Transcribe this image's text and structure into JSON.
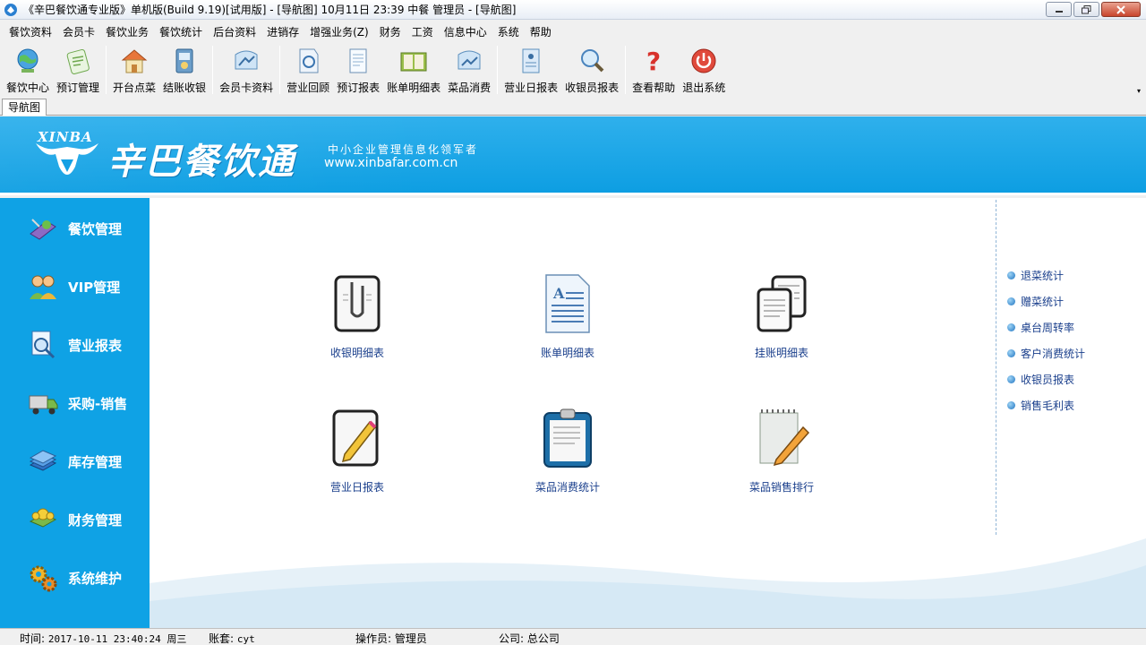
{
  "window": {
    "title": "《辛巴餐饮通专业版》单机版(Build 9.19)[试用版] - [导航图]  10月11日 23:39 中餐 管理员 - [导航图]"
  },
  "menu": [
    "餐饮资料",
    "会员卡",
    "餐饮业务",
    "餐饮统计",
    "后台资料",
    "进销存",
    "增强业务(Z)",
    "财务",
    "工资",
    "信息中心",
    "系统",
    "帮助"
  ],
  "toolbar": {
    "items": [
      {
        "label": "餐饮中心",
        "icon": "globe-icon"
      },
      {
        "label": "预订管理",
        "icon": "reservation-icon"
      },
      {
        "label": "开台点菜",
        "icon": "house-icon"
      },
      {
        "label": "结账收银",
        "icon": "cashier-icon"
      },
      {
        "label": "会员卡资料",
        "icon": "member-card-icon"
      },
      {
        "label": "营业回顾",
        "icon": "review-icon"
      },
      {
        "label": "预订报表",
        "icon": "document-icon"
      },
      {
        "label": "账单明细表",
        "icon": "book-icon"
      },
      {
        "label": "菜品消费",
        "icon": "chart-icon"
      },
      {
        "label": "营业日报表",
        "icon": "daily-report-icon"
      },
      {
        "label": "收银员报表",
        "icon": "magnifier-icon"
      },
      {
        "label": "查看帮助",
        "icon": "help-icon"
      },
      {
        "label": "退出系统",
        "icon": "power-icon"
      }
    ]
  },
  "tab": {
    "label": "导航图"
  },
  "banner": {
    "logo_en": "XINBA",
    "logo_cn": "辛巴餐饮通",
    "slogan": "中小企业管理信息化领军者",
    "url": "www.xinbafar.com.cn",
    "bg_color": "#13a0e4"
  },
  "nav": [
    {
      "label": "餐饮管理",
      "icon": "catering-icon"
    },
    {
      "label": "VIP管理",
      "icon": "vip-users-icon"
    },
    {
      "label": "营业报表",
      "icon": "report-search-icon"
    },
    {
      "label": "采购-销售",
      "icon": "truck-icon"
    },
    {
      "label": "库存管理",
      "icon": "stock-books-icon"
    },
    {
      "label": "财务管理",
      "icon": "finance-icon"
    },
    {
      "label": "系统维护",
      "icon": "gears-icon"
    }
  ],
  "content": {
    "items": [
      {
        "label": "收银明细表",
        "icon": "clip-document-icon"
      },
      {
        "label": "账单明细表",
        "icon": "text-document-icon"
      },
      {
        "label": "挂账明细表",
        "icon": "multi-document-icon"
      },
      {
        "label": "营业日报表",
        "icon": "pencil-document-icon"
      },
      {
        "label": "菜品消费统计",
        "icon": "clipboard-icon"
      },
      {
        "label": "菜品销售排行",
        "icon": "notepad-pencil-icon"
      }
    ],
    "quick_links": [
      "退菜统计",
      "赠菜统计",
      "桌台周转率",
      "客户消费统计",
      "收银员报表",
      "销售毛利表"
    ]
  },
  "status": {
    "time_label": "时间:",
    "time_value": "2017-10-11 23:40:24 周三",
    "account_label": "账套:",
    "account_value": "cyt",
    "operator_label": "操作员:",
    "operator_value": "管理员",
    "company_label": "公司:",
    "company_value": "总公司"
  }
}
